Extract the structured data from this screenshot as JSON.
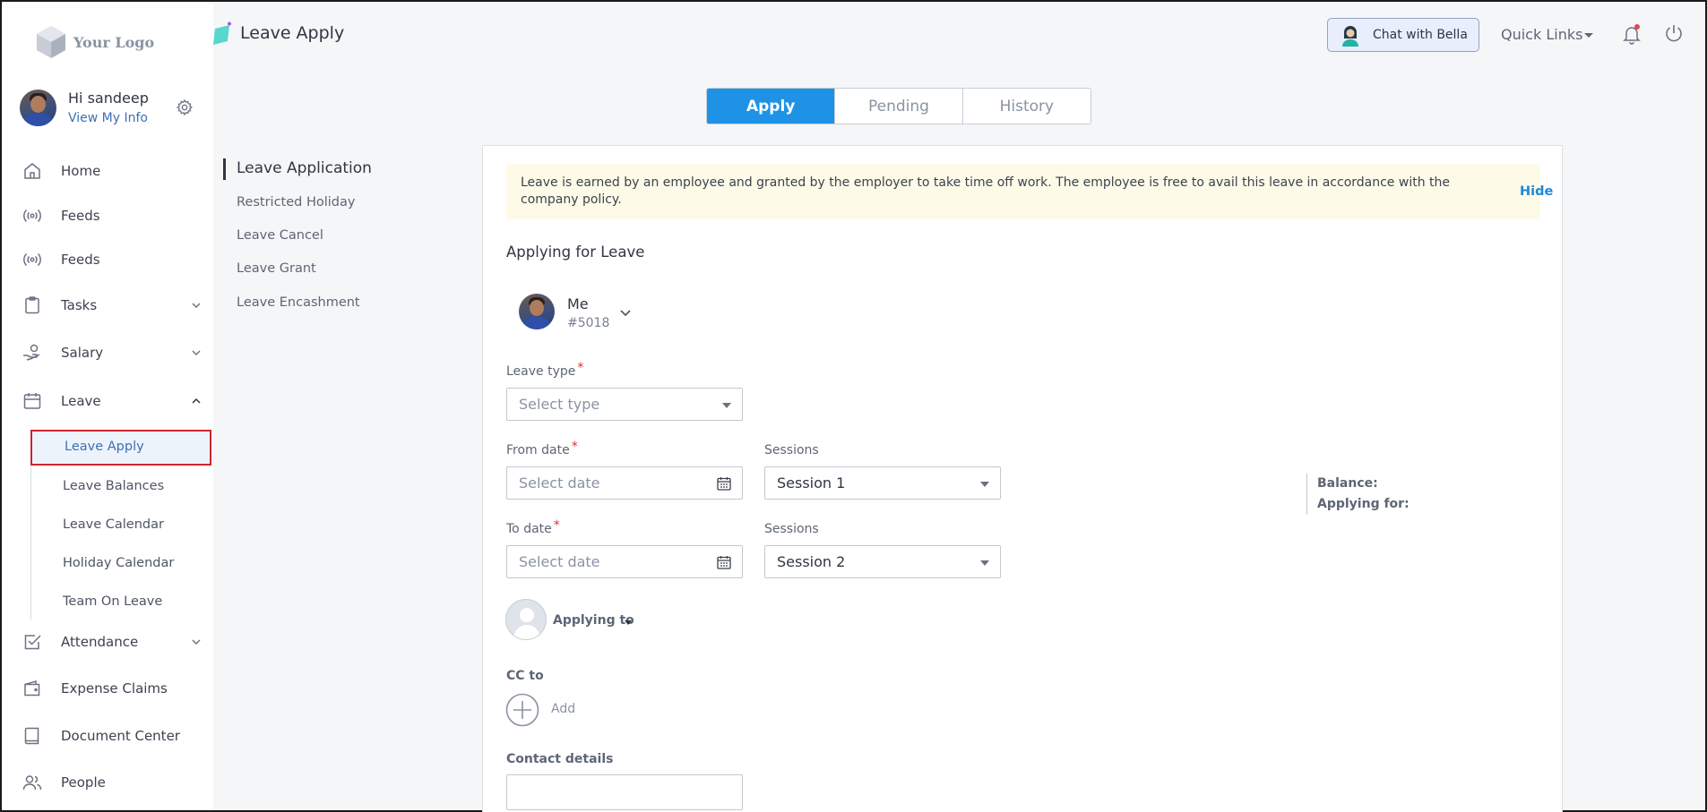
{
  "logo": {
    "text": "Your Logo"
  },
  "user": {
    "greeting": "Hi sandeep",
    "view_info": "View My Info"
  },
  "sidebar": {
    "items": [
      {
        "label": "Home",
        "icon": "home-icon"
      },
      {
        "label": "Feeds",
        "icon": "broadcast-icon"
      },
      {
        "label": "Feeds",
        "icon": "broadcast-icon"
      },
      {
        "label": "Tasks",
        "icon": "clipboard-icon"
      },
      {
        "label": "Salary",
        "icon": "hand-coin-icon"
      },
      {
        "label": "Leave",
        "icon": "calendar-icon"
      },
      {
        "label": "Attendance",
        "icon": "checkbox-icon"
      },
      {
        "label": "Expense Claims",
        "icon": "wallet-icon"
      },
      {
        "label": "Document Center",
        "icon": "book-icon"
      },
      {
        "label": "People",
        "icon": "people-icon"
      }
    ],
    "leave_sub": [
      "Leave Apply",
      "Leave Balances",
      "Leave Calendar",
      "Holiday Calendar",
      "Team On Leave"
    ]
  },
  "header": {
    "title": "Leave Apply",
    "chat_label": "Chat with Bella",
    "quick_links": "Quick Links"
  },
  "tabs": [
    "Apply",
    "Pending",
    "History"
  ],
  "inner_nav": [
    "Leave Application",
    "Restricted Holiday",
    "Leave Cancel",
    "Leave Grant",
    "Leave Encashment"
  ],
  "notice": {
    "text": "Leave is earned by an employee and granted by the employer to take time off work. The employee is free to avail this leave in accordance with the company policy.",
    "hide": "Hide"
  },
  "form": {
    "section_title": "Applying for Leave",
    "applicant_name": "Me",
    "applicant_id": "#5018",
    "leave_type_label": "Leave type",
    "leave_type_placeholder": "Select type",
    "from_date_label": "From date",
    "to_date_label": "To date",
    "date_placeholder": "Select date",
    "sessions_label": "Sessions",
    "from_session": "Session 1",
    "to_session": "Session 2",
    "balance_label": "Balance:",
    "applying_for_label": "Applying for:",
    "applying_to": "Applying to",
    "cc_label": "CC to",
    "add_label": "Add",
    "contact_label": "Contact details",
    "required_mark": "*"
  },
  "colors": {
    "accent": "#1e93e6",
    "required": "#d0343a",
    "link": "#3f6fb5",
    "highlight_border": "#c9262f"
  }
}
